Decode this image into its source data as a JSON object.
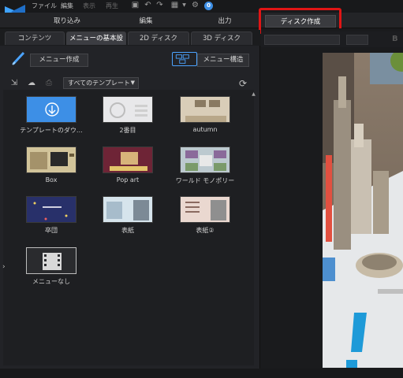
{
  "menubar": {
    "items": [
      "ファイル",
      "編集",
      "表示",
      "再生"
    ],
    "notification_count": "0"
  },
  "modes": {
    "tabs": [
      "取り込み",
      "編集",
      "出力",
      "ディスク作成"
    ],
    "active": "ディスク作成"
  },
  "subtabs": [
    "コンテンツ",
    "メニューの基本設定",
    "2D ディスク",
    "3D ディスク"
  ],
  "panel": {
    "create_menu_button": "メニュー作成",
    "menu_structure_button": "メニュー構造",
    "template_filter": "すべてのテンプレート"
  },
  "templates": [
    {
      "label": "テンプレートのダウ…"
    },
    {
      "label": "2番目"
    },
    {
      "label": "autumn"
    },
    {
      "label": "Box"
    },
    {
      "label": "Pop art"
    },
    {
      "label": "ワールド モノポリー"
    },
    {
      "label": "卒団"
    },
    {
      "label": "表紙"
    },
    {
      "label": "表紙②"
    },
    {
      "label": "メニューなし"
    }
  ],
  "colors": {
    "accent_blue": "#3d8fe6",
    "highlight_red": "#e01515",
    "download_tile": "#3d8fe6"
  }
}
